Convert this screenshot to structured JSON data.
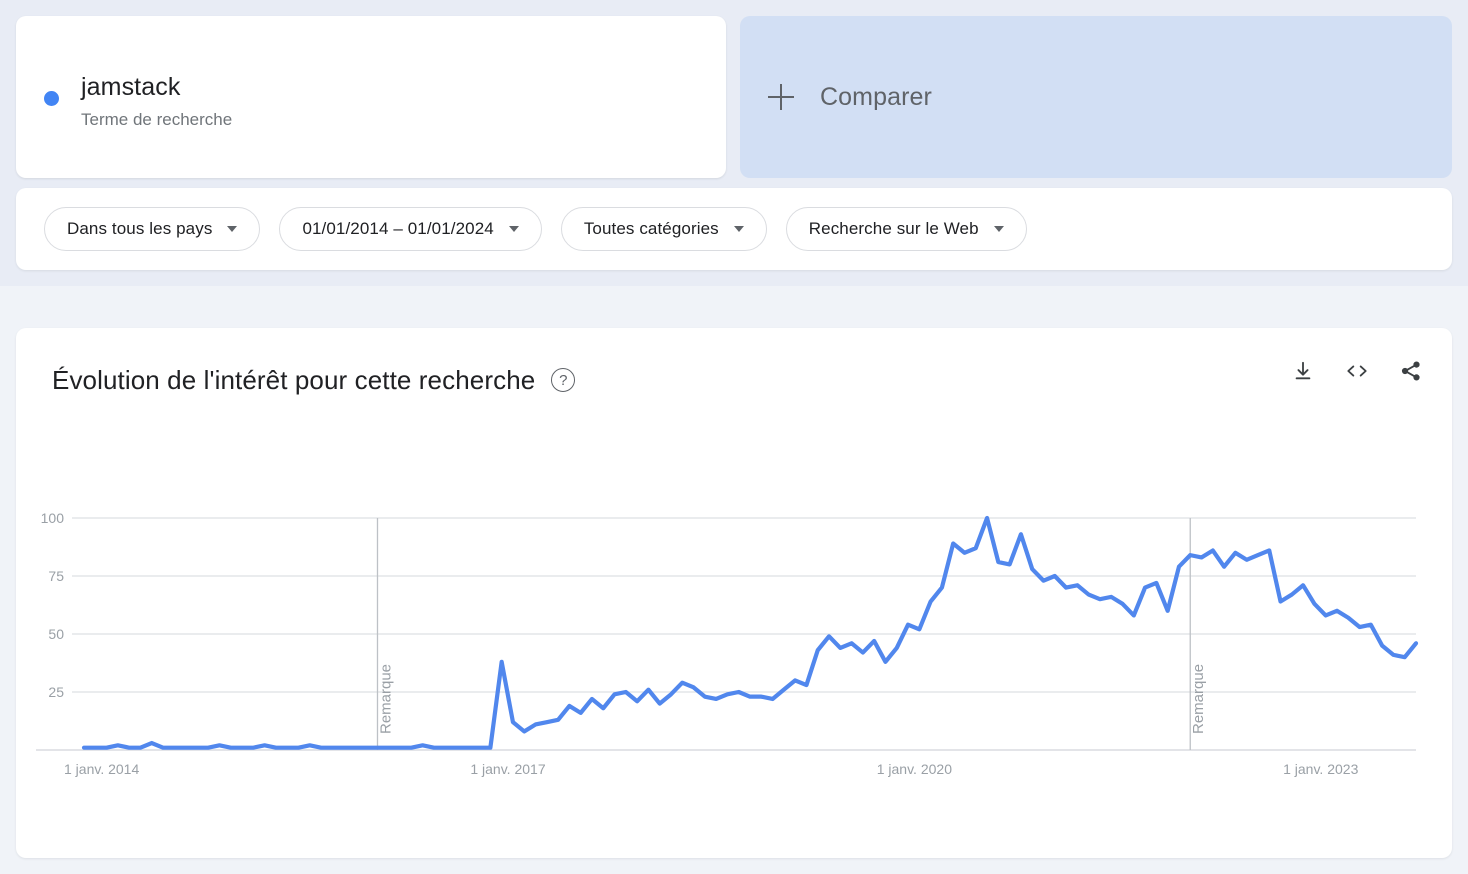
{
  "search_term": {
    "title": "jamstack",
    "subtitle": "Terme de recherche",
    "dot_color": "#4285f4"
  },
  "compare": {
    "label": "Comparer",
    "plus_icon": "plus-icon",
    "background": "#d2dff4"
  },
  "filters": [
    {
      "label": "Dans tous les pays",
      "name": "region-filter"
    },
    {
      "label": "01/01/2014 – 01/01/2024",
      "name": "date-range-filter"
    },
    {
      "label": "Toutes catégories",
      "name": "category-filter"
    },
    {
      "label": "Recherche sur le Web",
      "name": "search-type-filter"
    }
  ],
  "chart_card": {
    "title": "Évolution de l'intérêt pour cette recherche",
    "help_icon": "help-circle-icon",
    "actions": [
      {
        "name": "download-icon",
        "label": "download"
      },
      {
        "name": "embed-code-icon",
        "label": "<>"
      },
      {
        "name": "share-icon",
        "label": "share"
      }
    ]
  },
  "chart_data": {
    "type": "line",
    "title": "Évolution de l'intérêt pour cette recherche",
    "xlabel": "",
    "ylabel": "",
    "ylim": [
      0,
      100
    ],
    "y_ticks": [
      25,
      50,
      75,
      100
    ],
    "x_ticks": [
      "1 janv. 2014",
      "1 janv. 2017",
      "1 janv. 2020",
      "1 janv. 2023"
    ],
    "x_tick_positions": [
      0,
      36,
      72,
      108
    ],
    "grid": true,
    "legend": false,
    "line_color": "#5187ed",
    "annotations": [
      {
        "label": "Remarque",
        "x_index": 26
      },
      {
        "label": "Remarque",
        "x_index": 98
      }
    ],
    "series": [
      {
        "name": "jamstack",
        "color": "#5187ed",
        "values": [
          1,
          1,
          1,
          2,
          1,
          1,
          3,
          1,
          1,
          1,
          1,
          1,
          2,
          1,
          1,
          1,
          2,
          1,
          1,
          1,
          2,
          1,
          1,
          1,
          1,
          1,
          1,
          1,
          1,
          1,
          2,
          1,
          1,
          1,
          1,
          1,
          1,
          38,
          12,
          8,
          11,
          12,
          13,
          19,
          16,
          22,
          18,
          24,
          25,
          21,
          26,
          20,
          24,
          29,
          27,
          23,
          22,
          24,
          25,
          23,
          23,
          22,
          26,
          30,
          28,
          43,
          49,
          44,
          46,
          42,
          47,
          38,
          44,
          54,
          52,
          64,
          70,
          89,
          85,
          87,
          100,
          81,
          80,
          93,
          78,
          73,
          75,
          70,
          71,
          67,
          65,
          66,
          63,
          58,
          70,
          72,
          60,
          79,
          84,
          83,
          86,
          79,
          85,
          82,
          84,
          86,
          64,
          67,
          71,
          63,
          58,
          60,
          57,
          53,
          54,
          45,
          41,
          40,
          46
        ]
      }
    ]
  }
}
